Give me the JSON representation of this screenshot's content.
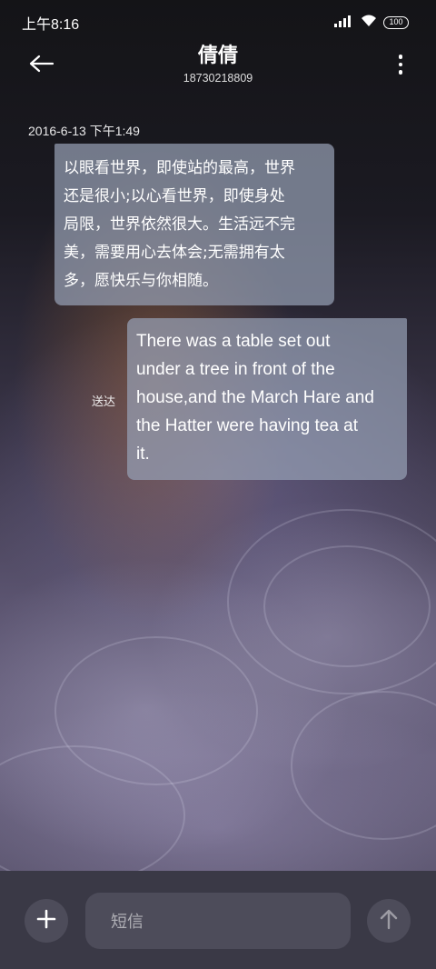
{
  "status_bar": {
    "time": "上午8:16",
    "battery": "100",
    "icons": [
      "signal-icon",
      "wifi-icon",
      "battery-icon"
    ]
  },
  "header": {
    "contact_name": "倩倩",
    "phone_number": "18730218809",
    "back_icon": "back-arrow-icon",
    "menu_icon": "more-vertical-icon"
  },
  "conversation": {
    "timestamp": "2016-6-13 下午1:49",
    "messages": [
      {
        "direction": "received",
        "lines": [
          "以眼看世界，即使站的最高，世界",
          "还是很小;以心看世界，即使身处",
          "局限，世界依然很大。生活远不完",
          "美，需要用心去体会;无需拥有太",
          "多，愿快乐与你相随。"
        ]
      },
      {
        "direction": "sent",
        "status": "送达",
        "lines": [
          "There was a table set out",
          "under a tree in front of the",
          "house,and the March Hare and",
          "the Hatter were having tea at",
          "it."
        ]
      }
    ]
  },
  "composer": {
    "placeholder": "短信",
    "add_icon": "plus-icon",
    "send_icon": "arrow-up-icon"
  },
  "colors": {
    "bubble": "#96a0b4",
    "input_bar": "#3a3946",
    "button_bg": "#4d4c5a"
  }
}
